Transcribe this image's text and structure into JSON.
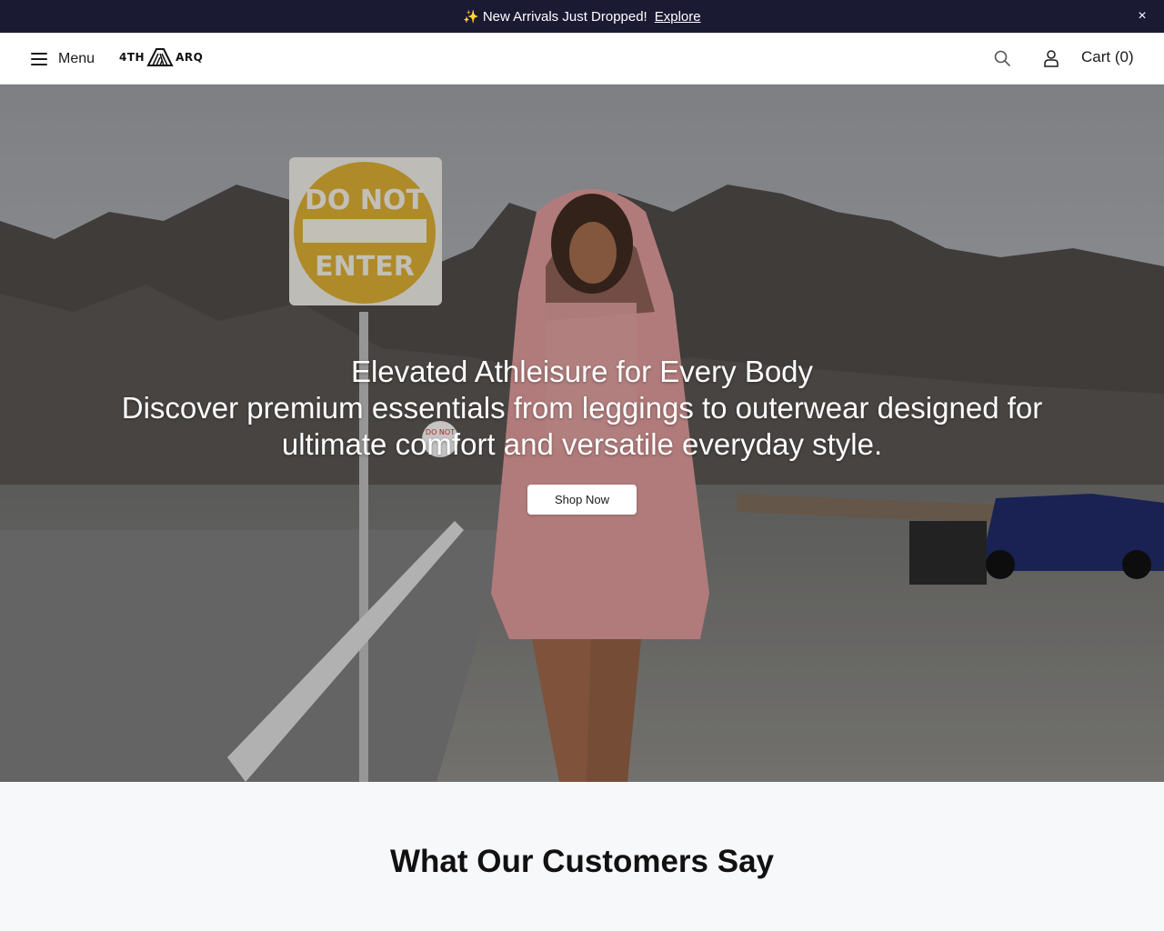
{
  "announcement": {
    "emoji": "✨",
    "text": "New Arrivals Just Dropped!",
    "link_label": "Explore",
    "close_label": "×"
  },
  "header": {
    "menu_label": "Menu",
    "logo_left": "4TH",
    "logo_right": "ARQ",
    "cart_label": "Cart (0)",
    "icons": [
      "hamburger-icon",
      "search-icon",
      "account-icon"
    ]
  },
  "hero": {
    "title": "Elevated Athleisure for Every Body",
    "subtitle": "Discover premium essentials from leggings to outerwear designed for ultimate comfort and versatile everyday style.",
    "cta_label": "Shop Now",
    "image_description": "Model in pink fleece pullover in front of desert mountains",
    "sign_text_top": "DO NOT",
    "sign_text_bottom": "ENTER",
    "small_sign_text": "DO NOT"
  },
  "testimonials": {
    "heading": "What Our Customers Say"
  },
  "colors": {
    "announcement_bg": "#1b1a33",
    "testimonials_bg": "#f7f8fa",
    "cta_bg": "#ffffff"
  }
}
